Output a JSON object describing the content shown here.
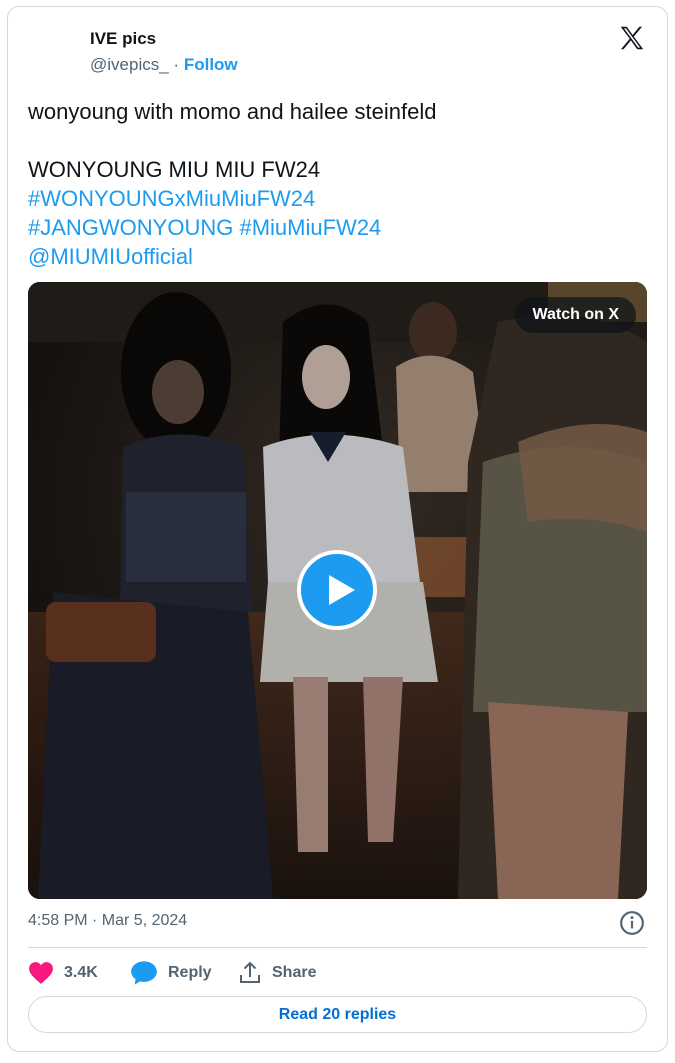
{
  "author": {
    "display_name": "IVE pics",
    "handle": "@ivepics_",
    "separator": "·",
    "follow_label": "Follow"
  },
  "tweet": {
    "lines": [
      "wonyoung with momo and hailee steinfeld",
      "WONYOUNG MIU MIU FW24",
      "#WONYOUNGxMiuMiuFW24",
      "#JANGWONYOUNG",
      "#MiuMiuFW24",
      "@MIUMIUofficial"
    ]
  },
  "media": {
    "watch_label": "Watch on X",
    "type": "video"
  },
  "meta": {
    "timestamp": "4:58 PM · Mar 5, 2024"
  },
  "actions": {
    "likes": "3.4K",
    "reply_label": "Reply",
    "share_label": "Share",
    "read_replies_label": "Read 20 replies"
  },
  "colors": {
    "link": "#1d9bf0",
    "like_heart": "#f91880",
    "muted_text": "#536471",
    "border": "#cfd9de"
  },
  "icons": [
    "x-logo-icon",
    "play-icon",
    "info-icon",
    "heart-icon",
    "reply-bubble-icon",
    "share-icon"
  ]
}
